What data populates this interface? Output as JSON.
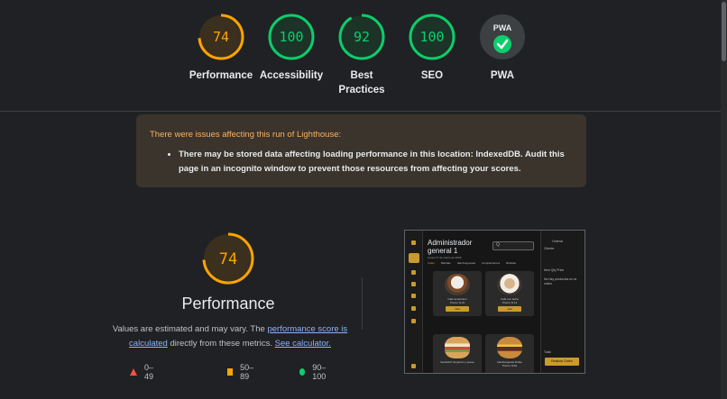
{
  "gauges": [
    {
      "score": "74",
      "value": 74,
      "label": "Performance",
      "color": "#ffa400",
      "fill": "#3b2f1e"
    },
    {
      "score": "100",
      "value": 100,
      "label": "Accessibility",
      "color": "#0cce6b",
      "fill": "#1c3328"
    },
    {
      "score": "92",
      "value": 92,
      "label": "Best Practices",
      "color": "#0cce6b",
      "fill": "#1c3328"
    },
    {
      "score": "100",
      "value": 100,
      "label": "SEO",
      "color": "#0cce6b",
      "fill": "#1c3328"
    },
    {
      "score": "PWA",
      "label": "PWA",
      "icon": "pwa-check-icon"
    }
  ],
  "warning": {
    "title": "There were issues affecting this run of Lighthouse:",
    "item": "There may be stored data affecting loading performance in this location: IndexedDB. Audit this page in an incognito window to prevent those resources from affecting your scores."
  },
  "performance": {
    "score": "74",
    "value": 74,
    "title": "Performance",
    "desc_prefix": "Values are estimated and may vary. The ",
    "link1": "performance score is calculated",
    "desc_middle": " directly from these metrics. ",
    "link2": "See calculator."
  },
  "legend": {
    "fail": "0–49",
    "average": "50–89",
    "pass": "90–100"
  },
  "thumbnail": {
    "title": "Administrador general 1",
    "subtitle": "Lunes 17 de marzo de 2025",
    "search": "Q",
    "tabs": [
      "Cafés",
      "Bebidas",
      "Hamburguesas",
      "Complementos",
      "Bebidas"
    ],
    "cards": [
      {
        "name": "Café americano\nPrecio: $ 10",
        "btn": "Add"
      },
      {
        "name": "Café con leche\nPrecio: $ 14",
        "btn": "Add"
      },
      {
        "name": "Sandwich de jamón y queso",
        "btn": ""
      },
      {
        "name": "Hamburguesa Doble\nPrecio: $ 60",
        "btn": ""
      }
    ],
    "right": {
      "r1": "Orderar",
      "r2": "Cliente:",
      "r3": "Item   Qty  Price",
      "r4": "No hay productos en la orden",
      "r5": "Total:",
      "btn": "Realizar Orden"
    }
  }
}
